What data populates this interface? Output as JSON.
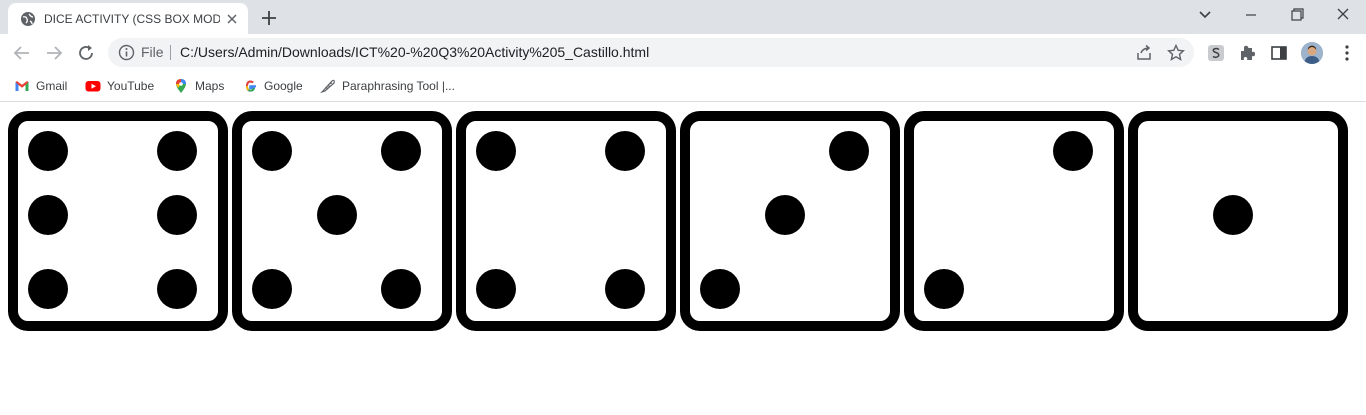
{
  "browser": {
    "tab": {
      "title": "DICE ACTIVITY (CSS BOX MODEL)",
      "favicon": "globe-icon"
    },
    "toolbar": {
      "url_chip": "File",
      "url": "C:/Users/Admin/Downloads/ICT%20-%20Q3%20Activity%205_Castillo.html"
    },
    "bookmarks": [
      {
        "label": "Gmail",
        "icon": "gmail-icon"
      },
      {
        "label": "YouTube",
        "icon": "youtube-icon"
      },
      {
        "label": "Maps",
        "icon": "maps-icon"
      },
      {
        "label": "Google",
        "icon": "google-icon"
      },
      {
        "label": "Paraphrasing Tool |...",
        "icon": "quill-icon"
      }
    ]
  },
  "page": {
    "dice": [
      {
        "face": 6
      },
      {
        "face": 5
      },
      {
        "face": 4
      },
      {
        "face": 3
      },
      {
        "face": 2
      },
      {
        "face": 1
      }
    ]
  },
  "colors": {
    "titlebar": "#dee1e6",
    "omnibox": "#f1f3f4",
    "die_border": "#000000",
    "pip": "#000000"
  }
}
